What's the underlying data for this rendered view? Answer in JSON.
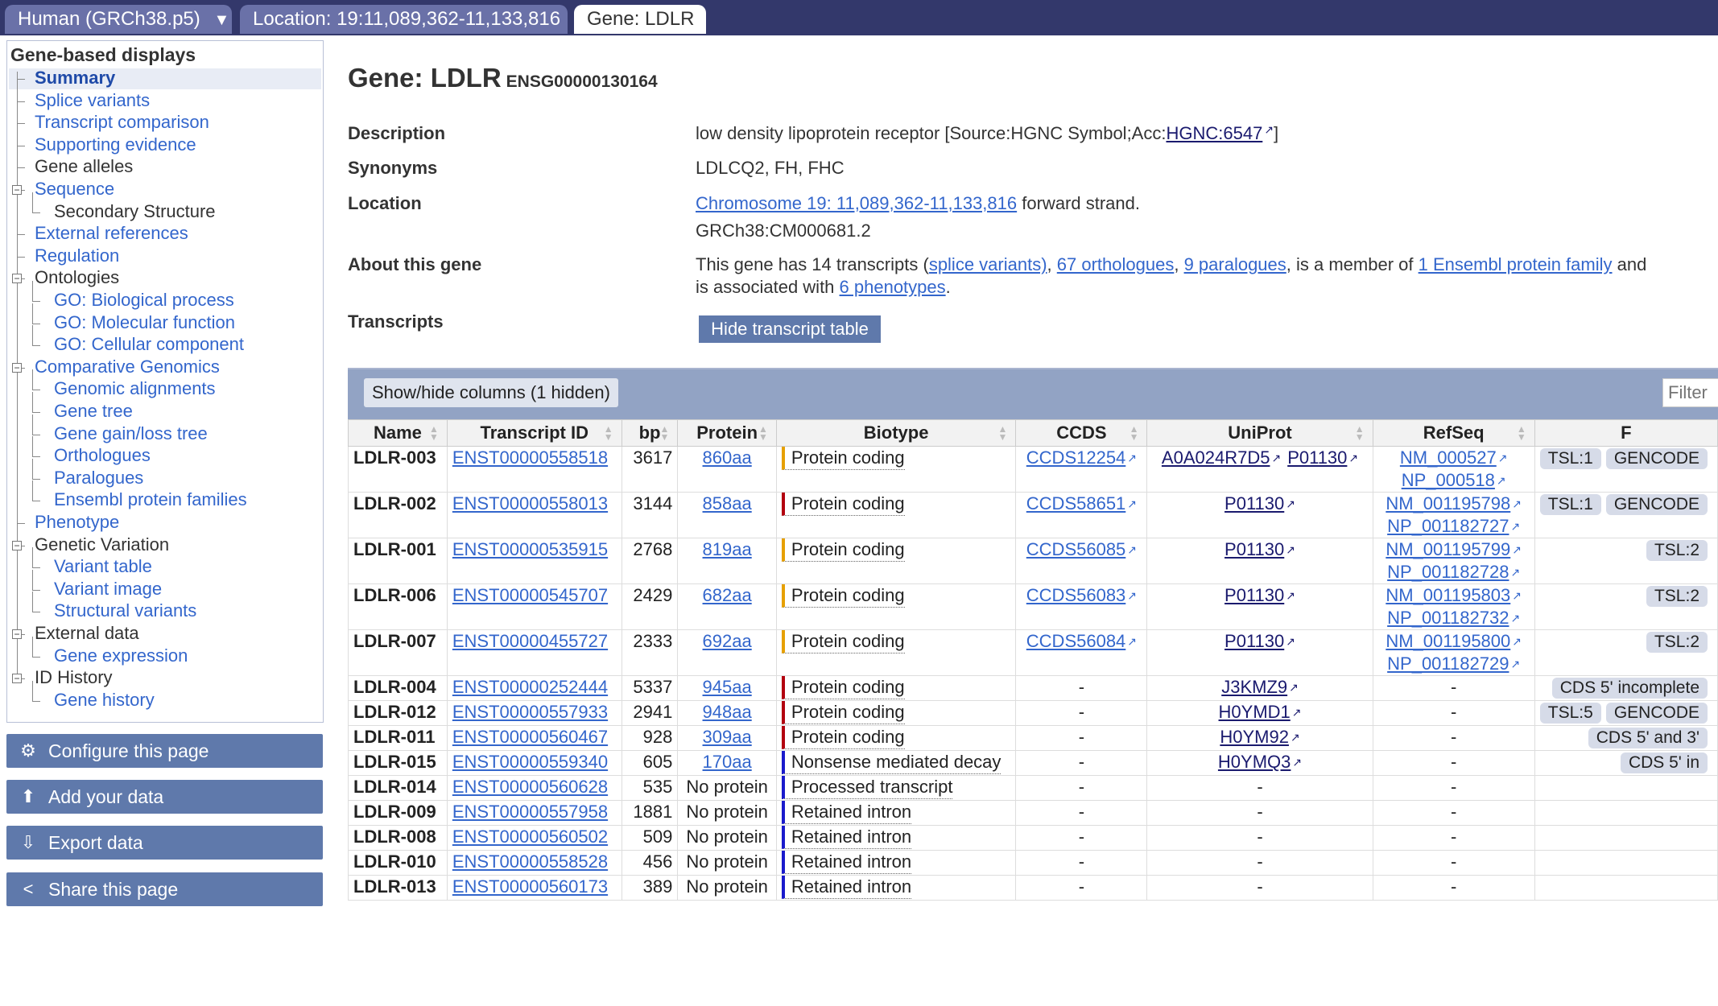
{
  "tabs": {
    "species": "Human (GRCh38.p5)",
    "species_arrow": "▼",
    "location": "Location: 19:11,089,362-11,133,816",
    "gene": "Gene: LDLR"
  },
  "sidebar": {
    "title": "Gene-based displays",
    "items": [
      {
        "label": "Summary"
      },
      {
        "label": "Splice variants"
      },
      {
        "label": "Transcript comparison"
      },
      {
        "label": "Supporting evidence"
      },
      {
        "label": "Gene alleles"
      },
      {
        "label": "Sequence"
      },
      {
        "label": "Secondary Structure"
      },
      {
        "label": "External references"
      },
      {
        "label": "Regulation"
      },
      {
        "label": "Ontologies"
      },
      {
        "label": "GO: Biological process"
      },
      {
        "label": "GO: Molecular function"
      },
      {
        "label": "GO: Cellular component"
      },
      {
        "label": "Comparative Genomics"
      },
      {
        "label": "Genomic alignments"
      },
      {
        "label": "Gene tree"
      },
      {
        "label": "Gene gain/loss tree"
      },
      {
        "label": "Orthologues"
      },
      {
        "label": "Paralogues"
      },
      {
        "label": "Ensembl protein families"
      },
      {
        "label": "Phenotype"
      },
      {
        "label": "Genetic Variation"
      },
      {
        "label": "Variant table"
      },
      {
        "label": "Variant image"
      },
      {
        "label": "Structural variants"
      },
      {
        "label": "External data"
      },
      {
        "label": "Gene expression"
      },
      {
        "label": "ID History"
      },
      {
        "label": "Gene history"
      }
    ],
    "buttons": {
      "configure": "Configure this page",
      "add_data": "Add your data",
      "export": "Export data",
      "share": "Share this page"
    }
  },
  "gene": {
    "title": "Gene: LDLR",
    "stable_id": "ENSG00000130164",
    "description_label": "Description",
    "description_text": "low density lipoprotein receptor [Source:HGNC Symbol;Acc:",
    "description_link": "HGNC:6547",
    "description_end": "]",
    "synonyms_label": "Synonyms",
    "synonyms": "LDLCQ2, FH, FHC",
    "location_label": "Location",
    "location_link": "Chromosome 19: 11,089,362-11,133,816",
    "location_strand": " forward strand.",
    "assembly": "GRCh38:CM000681.2",
    "about_label": "About this gene",
    "about": {
      "t1": "This gene has 14 transcripts (",
      "l1": "splice variants)",
      "t2": ", ",
      "l2": "67 orthologues",
      "t3": ", ",
      "l3": "9 paralogues",
      "t4": ", is a member of ",
      "l4": "1 Ensembl protein family",
      "t5": " and",
      "t6": "is associated with ",
      "l5": "6 phenotypes",
      "t7": "."
    },
    "transcripts_label": "Transcripts",
    "hide_button": "Hide transcript table"
  },
  "table": {
    "showhide": "Show/hide columns (1 hidden)",
    "filter_placeholder": "Filter",
    "columns": [
      "Name",
      "Transcript ID",
      "bp",
      "Protein",
      "Biotype",
      "CCDS",
      "UniProt",
      "RefSeq",
      "F"
    ],
    "rows": [
      {
        "name": "LDLR-003",
        "id": "ENST00000558518",
        "bp": "3617",
        "protein": "860aa",
        "biotype": "Protein coding",
        "bio_color": "#e6a000",
        "ccds": "CCDS12254",
        "uniprot": [
          "A0A024R7D5",
          "P01130"
        ],
        "refseq": [
          "NM_000527",
          "NP_000518"
        ],
        "flags": [
          "TSL:1",
          "GENCODE"
        ]
      },
      {
        "name": "LDLR-002",
        "id": "ENST00000558013",
        "bp": "3144",
        "protein": "858aa",
        "biotype": "Protein coding",
        "bio_color": "#b3000f",
        "ccds": "CCDS58651",
        "uniprot": [
          "P01130"
        ],
        "refseq": [
          "NM_001195798",
          "NP_001182727"
        ],
        "flags": [
          "TSL:1",
          "GENCODE"
        ]
      },
      {
        "name": "LDLR-001",
        "id": "ENST00000535915",
        "bp": "2768",
        "protein": "819aa",
        "biotype": "Protein coding",
        "bio_color": "#e6a000",
        "ccds": "CCDS56085",
        "uniprot": [
          "P01130"
        ],
        "refseq": [
          "NM_001195799",
          "NP_001182728"
        ],
        "flags": [
          "TSL:2"
        ]
      },
      {
        "name": "LDLR-006",
        "id": "ENST00000545707",
        "bp": "2429",
        "protein": "682aa",
        "biotype": "Protein coding",
        "bio_color": "#e6a000",
        "ccds": "CCDS56083",
        "uniprot": [
          "P01130"
        ],
        "refseq": [
          "NM_001195803",
          "NP_001182732"
        ],
        "flags": [
          "TSL:2"
        ]
      },
      {
        "name": "LDLR-007",
        "id": "ENST00000455727",
        "bp": "2333",
        "protein": "692aa",
        "biotype": "Protein coding",
        "bio_color": "#e6a000",
        "ccds": "CCDS56084",
        "uniprot": [
          "P01130"
        ],
        "refseq": [
          "NM_001195800",
          "NP_001182729"
        ],
        "flags": [
          "TSL:2"
        ]
      },
      {
        "name": "LDLR-004",
        "id": "ENST00000252444",
        "bp": "5337",
        "protein": "945aa",
        "biotype": "Protein coding",
        "bio_color": "#b3000f",
        "ccds": "-",
        "uniprot": [
          "J3KMZ9"
        ],
        "refseq": [
          "-"
        ],
        "flags": [
          "CDS 5' incomplete"
        ]
      },
      {
        "name": "LDLR-012",
        "id": "ENST00000557933",
        "bp": "2941",
        "protein": "948aa",
        "biotype": "Protein coding",
        "bio_color": "#b3000f",
        "ccds": "-",
        "uniprot": [
          "H0YMD1"
        ],
        "refseq": [
          "-"
        ],
        "flags": [
          "TSL:5",
          "GENCODE"
        ]
      },
      {
        "name": "LDLR-011",
        "id": "ENST00000560467",
        "bp": "928",
        "protein": "309aa",
        "biotype": "Protein coding",
        "bio_color": "#b3000f",
        "ccds": "-",
        "uniprot": [
          "H0YM92"
        ],
        "refseq": [
          "-"
        ],
        "flags": [
          "CDS 5' and 3'"
        ]
      },
      {
        "name": "LDLR-015",
        "id": "ENST00000559340",
        "bp": "605",
        "protein": "170aa",
        "biotype": "Nonsense mediated decay",
        "bio_color": "#1a1acc",
        "ccds": "-",
        "uniprot": [
          "H0YMQ3"
        ],
        "refseq": [
          "-"
        ],
        "flags": [
          "CDS 5' in"
        ]
      },
      {
        "name": "LDLR-014",
        "id": "ENST00000560628",
        "bp": "535",
        "protein": "No protein",
        "biotype": "Processed transcript",
        "bio_color": "#1a1acc",
        "ccds": "-",
        "uniprot": [
          "-"
        ],
        "refseq": [
          "-"
        ],
        "flags": []
      },
      {
        "name": "LDLR-009",
        "id": "ENST00000557958",
        "bp": "1881",
        "protein": "No protein",
        "biotype": "Retained intron",
        "bio_color": "#1a1acc",
        "ccds": "-",
        "uniprot": [
          "-"
        ],
        "refseq": [
          "-"
        ],
        "flags": []
      },
      {
        "name": "LDLR-008",
        "id": "ENST00000560502",
        "bp": "509",
        "protein": "No protein",
        "biotype": "Retained intron",
        "bio_color": "#1a1acc",
        "ccds": "-",
        "uniprot": [
          "-"
        ],
        "refseq": [
          "-"
        ],
        "flags": []
      },
      {
        "name": "LDLR-010",
        "id": "ENST00000558528",
        "bp": "456",
        "protein": "No protein",
        "biotype": "Retained intron",
        "bio_color": "#1a1acc",
        "ccds": "-",
        "uniprot": [
          "-"
        ],
        "refseq": [
          "-"
        ],
        "flags": []
      },
      {
        "name": "LDLR-013",
        "id": "ENST00000560173",
        "bp": "389",
        "protein": "No protein",
        "biotype": "Retained intron",
        "bio_color": "#1a1acc",
        "ccds": "-",
        "uniprot": [
          "-"
        ],
        "refseq": [
          "-"
        ],
        "flags": []
      }
    ]
  }
}
